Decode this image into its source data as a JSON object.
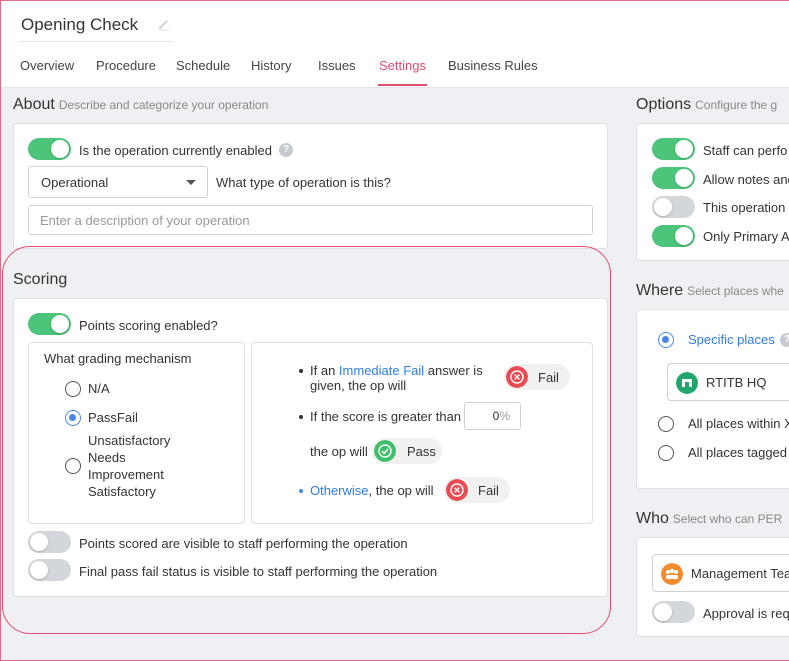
{
  "header": {
    "title": "Opening Check",
    "tabs": [
      {
        "label": "Overview"
      },
      {
        "label": "Procedure"
      },
      {
        "label": "Schedule"
      },
      {
        "label": "History"
      },
      {
        "label": "Issues"
      },
      {
        "label": "Settings",
        "active": true
      },
      {
        "label": "Business Rules"
      }
    ]
  },
  "about": {
    "heading": "About",
    "subtitle": "Describe and categorize your operation",
    "enabled_label": "Is the operation currently enabled",
    "enabled": true,
    "type_value": "Operational",
    "type_question": "What type of operation is this?",
    "description_placeholder": "Enter a description of your operation"
  },
  "scoring": {
    "heading": "Scoring",
    "points_enabled_label": "Points scoring enabled?",
    "points_enabled": true,
    "grading_title": "What grading mechanism",
    "grading_options": [
      {
        "label": "N/A",
        "selected": false
      },
      {
        "label": "PassFail",
        "selected": true
      },
      {
        "label_lines": [
          "Unsatisfactory",
          "Needs",
          "Improvement",
          "Satisfactory"
        ],
        "selected": false
      }
    ],
    "rules": {
      "immediate_prefix": "If an ",
      "immediate_link": "Immediate Fail",
      "immediate_suffix_1": " answer is",
      "immediate_suffix_2": "given, the op will",
      "immediate_result": "Fail",
      "score_text": "If the score is greater than",
      "score_value": "0",
      "score_unit": "%",
      "score_then": "the op will",
      "score_result": "Pass",
      "otherwise_link": "Otherwise",
      "otherwise_suffix": ", the op will",
      "otherwise_result": "Fail"
    },
    "visible_points_label": "Points scored are visible to staff performing the operation",
    "visible_points": false,
    "visible_status_label": "Final pass fail status is visible to staff performing the operation",
    "visible_status": false
  },
  "options": {
    "heading": "Options",
    "subtitle": "Configure the g",
    "items": [
      {
        "label": "Staff can perfo",
        "on": true
      },
      {
        "label": "Allow notes and",
        "on": true
      },
      {
        "label": "This operation",
        "on": false
      },
      {
        "label": "Only Primary A",
        "on": true
      }
    ]
  },
  "where": {
    "heading": "Where",
    "subtitle": "Select places whe",
    "specific_label": "Specific places",
    "place_name": "RTITB HQ",
    "all_within": "All places within X",
    "all_tagged": "All places tagged"
  },
  "who": {
    "heading": "Who",
    "subtitle": "Select who can PER",
    "team_name": "Management Tea",
    "approval_label": "Approval is req"
  },
  "colors": {
    "accent": "#e04e6e",
    "toggle_on": "#4cc47a",
    "link": "#2f7de1",
    "fail": "#ea4b52",
    "pass": "#3fbf6a",
    "place_icon": "#21a56a",
    "team_icon": "#f28a2e"
  }
}
